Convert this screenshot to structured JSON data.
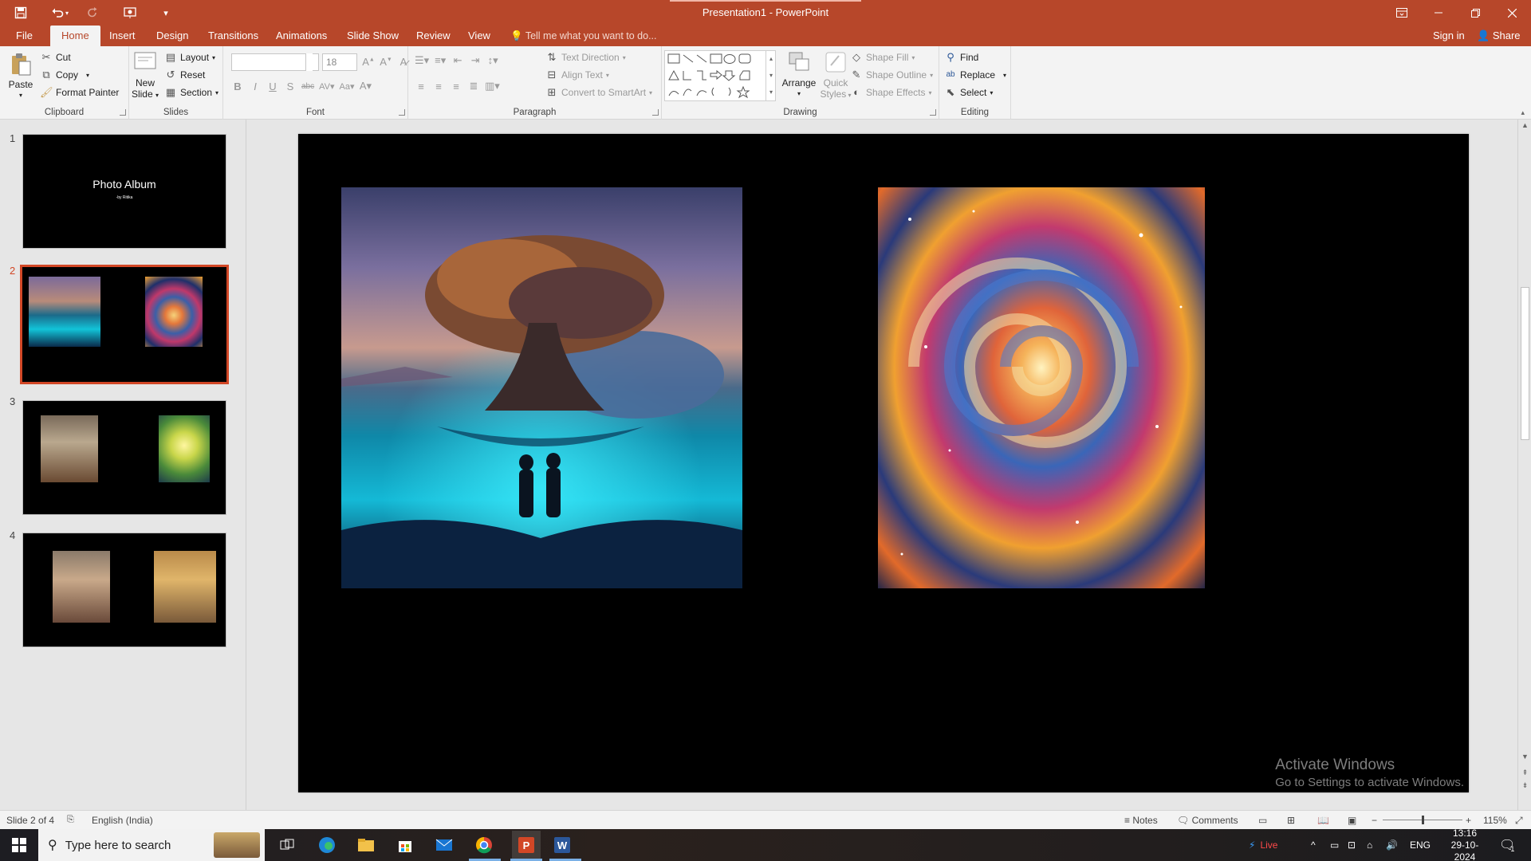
{
  "titlebar": {
    "title": "Presentation1  -  PowerPoint"
  },
  "tabs": [
    "File",
    "Home",
    "Insert",
    "Design",
    "Transitions",
    "Animations",
    "Slide Show",
    "Review",
    "View"
  ],
  "tellme": "Tell me what you want to do...",
  "account": {
    "signin": "Sign in",
    "share": "Share"
  },
  "ribbon": {
    "clipboard": {
      "paste": "Paste",
      "cut": "Cut",
      "copy": "Copy",
      "format_painter": "Format Painter",
      "label": "Clipboard"
    },
    "slides": {
      "new_slide_1": "New",
      "new_slide_2": "Slide",
      "layout": "Layout",
      "reset": "Reset",
      "section": "Section",
      "label": "Slides"
    },
    "font": {
      "font_name": "",
      "font_size": "18",
      "label": "Font"
    },
    "paragraph": {
      "text_direction": "Text Direction",
      "align_text": "Align Text",
      "convert_smartart": "Convert to SmartArt",
      "label": "Paragraph"
    },
    "drawing": {
      "arrange": "Arrange",
      "quick_styles_1": "Quick",
      "quick_styles_2": "Styles",
      "shape_fill": "Shape Fill",
      "shape_outline": "Shape Outline",
      "shape_effects": "Shape Effects",
      "label": "Drawing"
    },
    "editing": {
      "find": "Find",
      "replace": "Replace",
      "select": "Select",
      "label": "Editing"
    }
  },
  "slides_panel": {
    "slides": [
      {
        "number": "1",
        "title": "Photo Album",
        "subtitle": "-by Ritika"
      },
      {
        "number": "2"
      },
      {
        "number": "3"
      },
      {
        "number": "4"
      }
    ],
    "selected": 2
  },
  "watermark": {
    "line1": "Activate Windows",
    "line2": "Go to Settings to activate Windows."
  },
  "statusbar": {
    "slide_info": "Slide 2 of 4",
    "language": "English (India)",
    "notes": "Notes",
    "comments": "Comments",
    "zoom": "115%"
  },
  "taskbar": {
    "search_placeholder": "Type here to search",
    "live": "Live",
    "language": "ENG",
    "time": "13:16",
    "date": "29-10-2024",
    "notifications": "1"
  },
  "colors": {
    "accent": "#b7472a",
    "selection": "#d24726"
  }
}
